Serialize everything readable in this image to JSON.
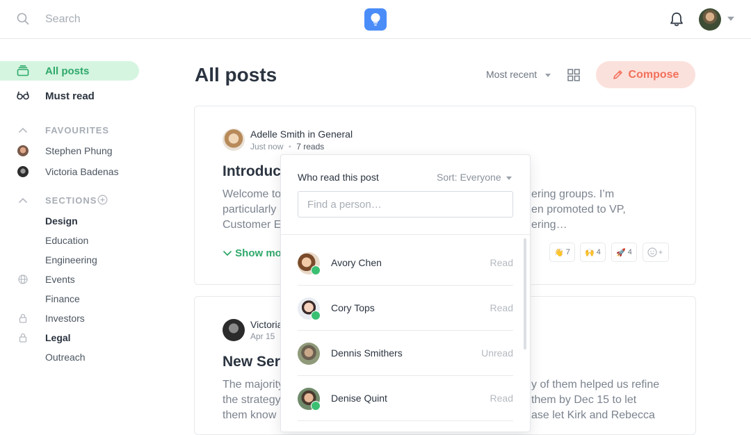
{
  "header": {
    "search_placeholder": "Search"
  },
  "sidebar": {
    "nav": [
      {
        "label": "All posts",
        "icon": "stack-icon",
        "active": true
      },
      {
        "label": "Must read",
        "icon": "glasses-icon",
        "active": false
      }
    ],
    "favourites": {
      "heading": "FAVOURITES",
      "items": [
        {
          "label": "Stephen Phung"
        },
        {
          "label": "Victoria Badenas"
        }
      ]
    },
    "sections": {
      "heading": "SECTIONS",
      "items": [
        {
          "label": "Design",
          "bold": true,
          "icon": ""
        },
        {
          "label": "Education",
          "bold": false,
          "icon": ""
        },
        {
          "label": "Engineering",
          "bold": false,
          "icon": ""
        },
        {
          "label": "Events",
          "bold": false,
          "icon": "globe-icon"
        },
        {
          "label": "Finance",
          "bold": false,
          "icon": ""
        },
        {
          "label": "Investors",
          "bold": false,
          "icon": "lock-icon"
        },
        {
          "label": "Legal",
          "bold": true,
          "icon": "lock-icon"
        },
        {
          "label": "Outreach",
          "bold": false,
          "icon": ""
        }
      ]
    }
  },
  "main": {
    "title": "All posts",
    "sort_label": "Most recent",
    "compose_label": "Compose"
  },
  "posts": [
    {
      "author": "Adelle Smith in General",
      "time": "Just now",
      "reads": "7 reads",
      "title_visible": "Introduc",
      "body_left": [
        "Welcome to",
        "particularly",
        "Customer E"
      ],
      "body_right": [
        "ering groups. I’m",
        "en promoted to VP,",
        "ering…"
      ],
      "show_more": "Show mor",
      "reactions": [
        {
          "emoji": "👋",
          "count": "7"
        },
        {
          "emoji": "🙌",
          "count": "4"
        },
        {
          "emoji": "🚀",
          "count": "4"
        }
      ]
    },
    {
      "author": "Victoria",
      "time": "Apr 15",
      "title_visible": "New Ser",
      "body_left": [
        "The majority",
        "the strategy",
        "them know"
      ],
      "body_right": [
        "y of them helped us refine",
        "them by Dec 15 to let",
        "ase let Kirk and Rebecca"
      ]
    }
  ],
  "readers_popup": {
    "title": "Who read this post",
    "sort_label": "Sort: Everyone",
    "find_placeholder": "Find a person…",
    "readers": [
      {
        "name": "Avory Chen",
        "status": "Read",
        "checked": true
      },
      {
        "name": "Cory Tops",
        "status": "Read",
        "checked": true
      },
      {
        "name": "Dennis Smithers",
        "status": "Unread",
        "checked": false
      },
      {
        "name": "Denise Quint",
        "status": "Read",
        "checked": true
      }
    ]
  },
  "colors": {
    "accent_green": "#2ea86a",
    "active_bg": "#d5f5e0",
    "compose_bg": "#fbe1dc",
    "compose_text": "#f2705a",
    "logo_blue": "#4b8df8"
  }
}
